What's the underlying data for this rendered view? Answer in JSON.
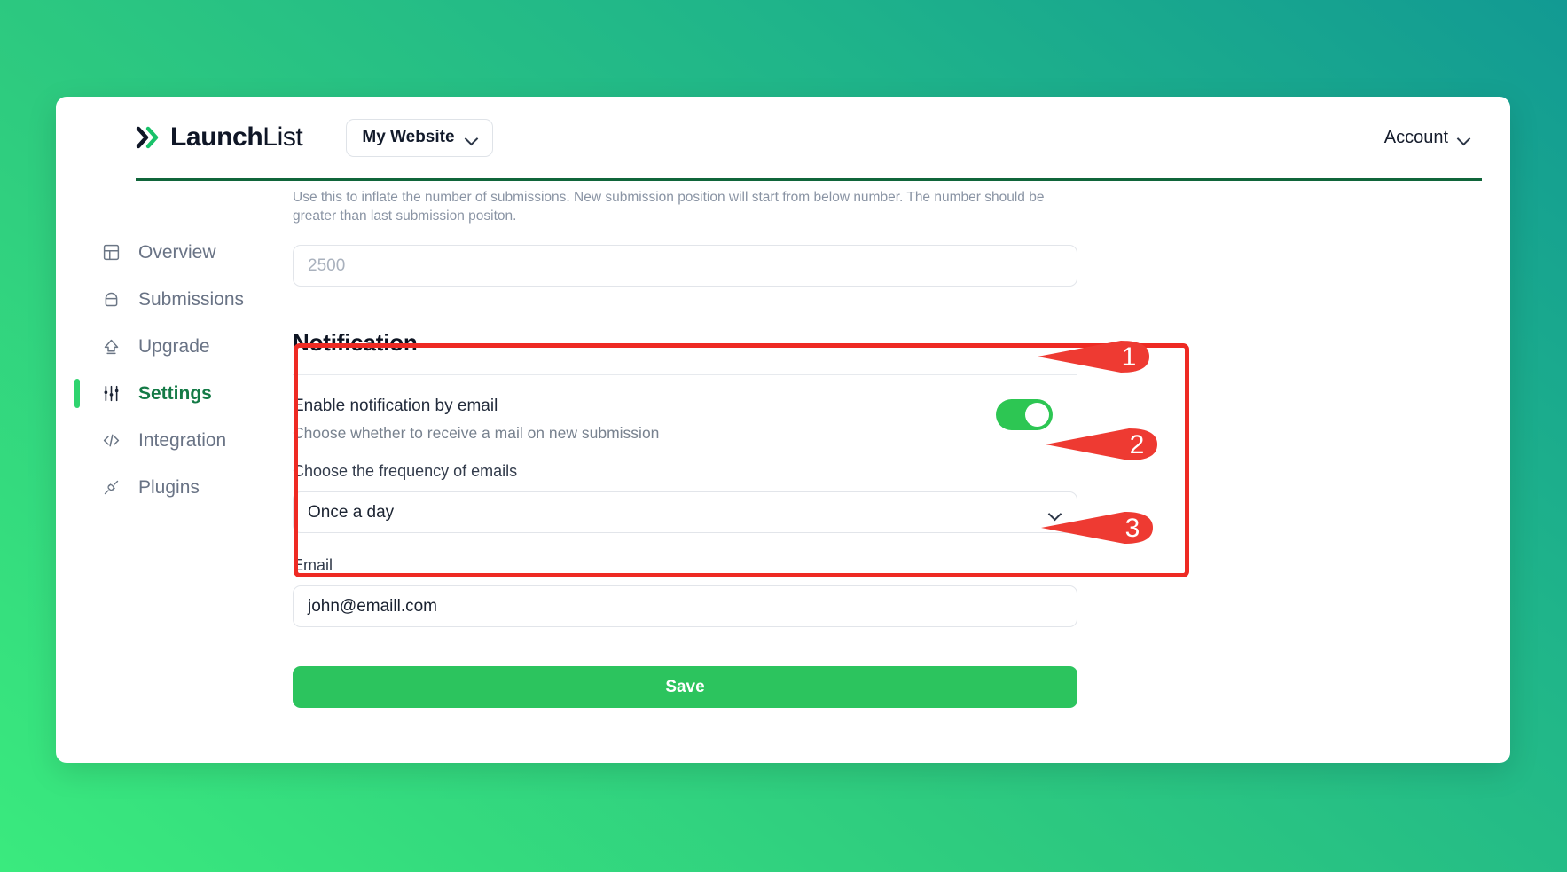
{
  "header": {
    "brand_bold": "Launch",
    "brand_light": "List",
    "brand_mark_icon": "double-chevron-right-icon",
    "site_selector_label": "My Website",
    "site_selector_icon": "chevron-down-icon",
    "account_label": "Account",
    "account_icon": "chevron-down-icon"
  },
  "sidebar": {
    "items": [
      {
        "label": "Overview",
        "icon": "dashboard-grid-icon",
        "active": false
      },
      {
        "label": "Submissions",
        "icon": "inbox-icon",
        "active": false
      },
      {
        "label": "Upgrade",
        "icon": "upload-arrow-icon",
        "active": false
      },
      {
        "label": "Settings",
        "icon": "sliders-icon",
        "active": true
      },
      {
        "label": "Integration",
        "icon": "code-brackets-icon",
        "active": false
      },
      {
        "label": "Plugins",
        "icon": "plug-connector-icon",
        "active": false
      }
    ]
  },
  "main": {
    "inflate": {
      "helper_text": "Use this to inflate the number of submissions. New submission position will start from below number. The number should be greater than last submission positon.",
      "input_placeholder": "2500",
      "input_value": ""
    },
    "notification": {
      "section_title": "Notification",
      "enable_title": "Enable notification by email",
      "enable_subtitle": "Choose whether to receive a mail on new submission",
      "toggle_state": "on",
      "frequency_label": "Choose the frequency of emails",
      "frequency_value": "Once a day",
      "frequency_icon": "chevron-down-icon",
      "email_label": "Email",
      "email_value": "john@emaill.com"
    },
    "save_label": "Save"
  },
  "annotations": {
    "callout_color": "#ee2a23",
    "markers": [
      {
        "number": "1",
        "target": "notification-toggle"
      },
      {
        "number": "2",
        "target": "frequency-select"
      },
      {
        "number": "3",
        "target": "email-input"
      }
    ]
  }
}
